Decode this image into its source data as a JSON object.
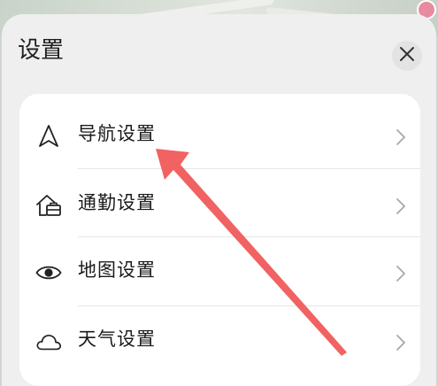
{
  "sheet": {
    "title": "设置"
  },
  "close": {
    "icon": "close-icon"
  },
  "settings": {
    "items": [
      {
        "label": "导航设置",
        "icon": "navigation-arrow-icon"
      },
      {
        "label": "通勤设置",
        "icon": "home-briefcase-icon"
      },
      {
        "label": "地图设置",
        "icon": "eye-icon"
      },
      {
        "label": "天气设置",
        "icon": "cloud-icon"
      }
    ]
  },
  "colors": {
    "sheet_bg": "#efefef",
    "card_bg": "#ffffff",
    "annotation_arrow": "#f05a5a"
  }
}
